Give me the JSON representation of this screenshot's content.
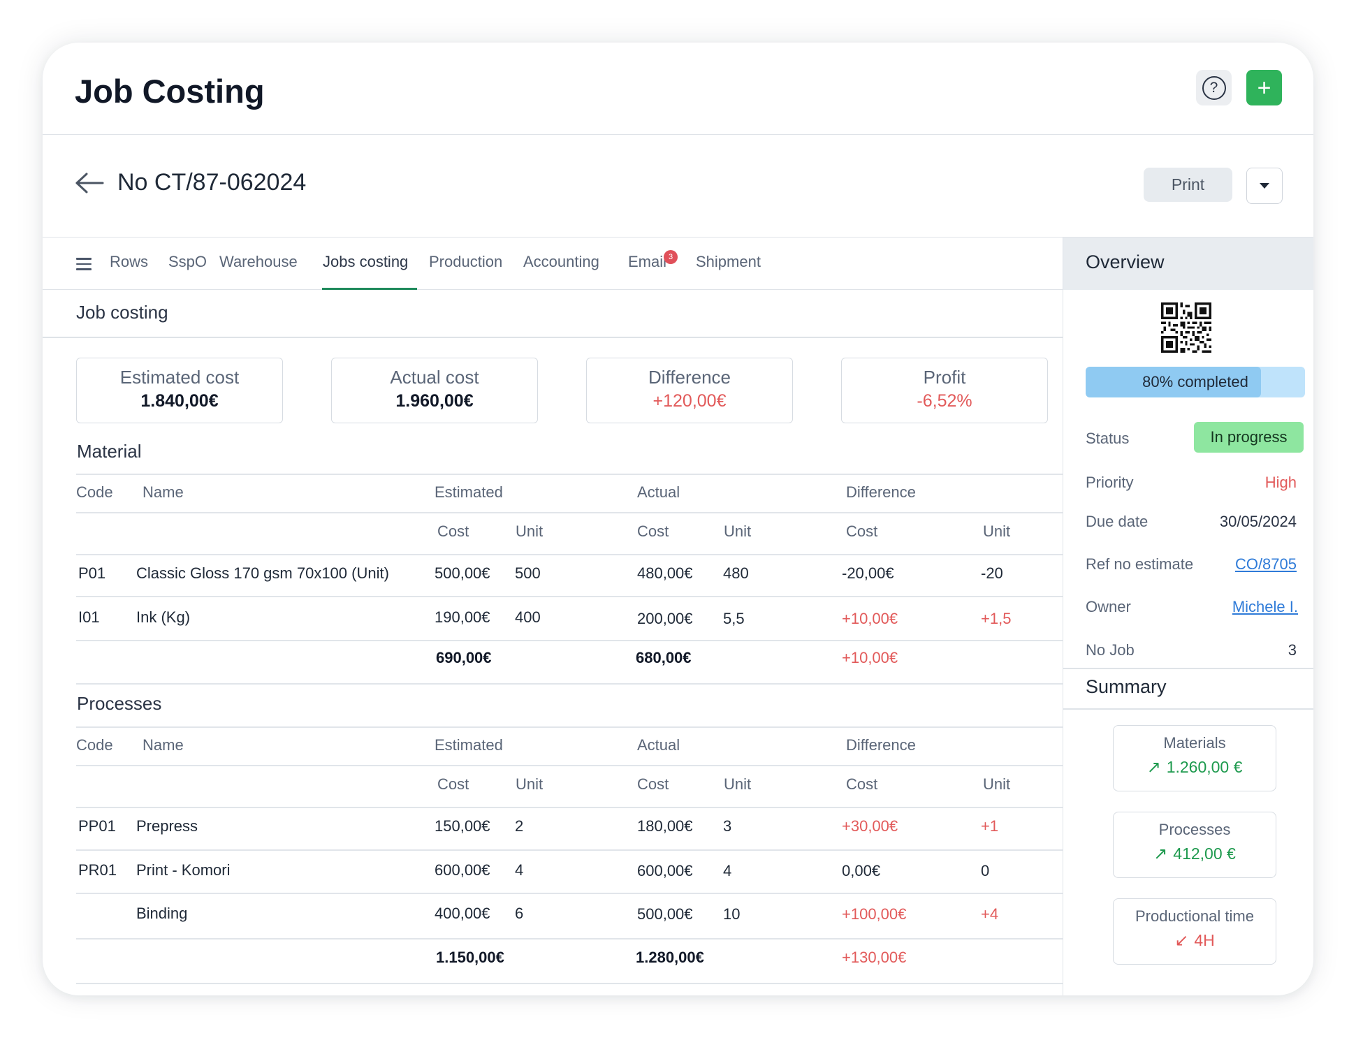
{
  "app": {
    "title": "Job Costing"
  },
  "document": {
    "number": "No CT/87-062024",
    "print_label": "Print"
  },
  "tabs": [
    {
      "label": "Rows"
    },
    {
      "label": "SspO"
    },
    {
      "label": "Warehouse"
    },
    {
      "label": "Jobs costing",
      "active": true
    },
    {
      "label": "Production"
    },
    {
      "label": "Accounting"
    },
    {
      "label": "Email",
      "badge": "3"
    },
    {
      "label": "Shipment"
    }
  ],
  "section_title": "Job costing",
  "kpis": [
    {
      "label": "Estimated cost",
      "value": "1.840,00€"
    },
    {
      "label": "Actual cost",
      "value": "1.960,00€"
    },
    {
      "label": "Difference",
      "value": "+120,00€"
    },
    {
      "label": "Profit",
      "value": "-6,52%"
    }
  ],
  "headers": {
    "code": "Code",
    "name": "Name",
    "estimated": "Estimated",
    "actual": "Actual",
    "difference": "Difference",
    "cost": "Cost",
    "unit": "Unit"
  },
  "material": {
    "title": "Material",
    "rows": [
      {
        "code": "P01",
        "name": "Classic Gloss 170 gsm 70x100 (Unit)",
        "est_cost": "500,00€",
        "est_unit": "500",
        "act_cost": "480,00€",
        "act_unit": "480",
        "diff_cost": "-20,00€",
        "diff_unit": "-20"
      },
      {
        "code": "I01",
        "name": "Ink (Kg)",
        "est_cost": "190,00€",
        "est_unit": "400",
        "act_cost": "200,00€",
        "act_unit": "5,5",
        "diff_cost": "+10,00€",
        "diff_unit": "+1,5"
      }
    ],
    "total": {
      "est_cost": "690,00€",
      "act_cost": "680,00€",
      "diff_cost": "+10,00€"
    }
  },
  "processes": {
    "title": "Processes",
    "rows": [
      {
        "code": "PP01",
        "name": "Prepress",
        "est_cost": "150,00€",
        "est_unit": "2",
        "act_cost": "180,00€",
        "act_unit": "3",
        "diff_cost": "+30,00€",
        "diff_unit": "+1"
      },
      {
        "code": "PR01",
        "name": "Print - Komori",
        "est_cost": "600,00€",
        "est_unit": "4",
        "act_cost": "600,00€",
        "act_unit": "4",
        "diff_cost": "0,00€",
        "diff_unit": "0"
      },
      {
        "code": "",
        "name": "Binding",
        "est_cost": "400,00€",
        "est_unit": "6",
        "act_cost": "500,00€",
        "act_unit": "10",
        "diff_cost": "+100,00€",
        "diff_unit": "+4"
      }
    ],
    "total": {
      "est_cost": "1.150,00€",
      "act_cost": "1.280,00€",
      "diff_cost": "+130,00€"
    }
  },
  "overview": {
    "title": "Overview",
    "progress": {
      "percent": 80,
      "label": "80% completed"
    },
    "status": {
      "label": "Status",
      "value": "In progress"
    },
    "priority": {
      "label": "Priority",
      "value": "High"
    },
    "due_date": {
      "label": "Due date",
      "value": "30/05/2024"
    },
    "ref_no": {
      "label": "Ref no estimate",
      "value": "CO/8705"
    },
    "owner": {
      "label": "Owner",
      "value": "Michele I."
    },
    "no_job": {
      "label": "No Job",
      "value": "3"
    }
  },
  "summary": {
    "title": "Summary",
    "cards": [
      {
        "label": "Materials",
        "value": "1.260,00 €",
        "trend": "up"
      },
      {
        "label": "Processes",
        "value": "412,00 €",
        "trend": "up"
      },
      {
        "label": "Productional time",
        "value": "4H",
        "trend": "down"
      }
    ]
  },
  "colors": {
    "accent_green": "#2fb35b",
    "negative_red": "#e25a5a",
    "link_blue": "#2f7bd8",
    "tab_underline": "#1f8a5c"
  }
}
